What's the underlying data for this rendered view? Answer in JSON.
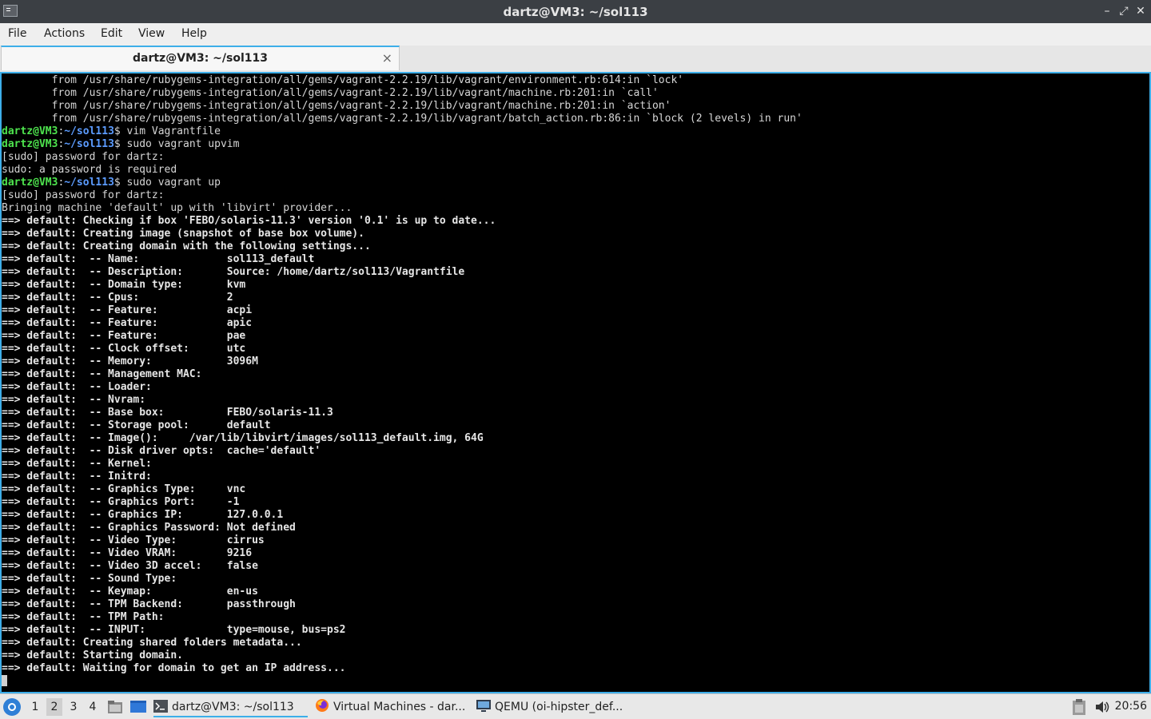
{
  "window": {
    "title": "dartz@VM3: ~/sol113"
  },
  "menu": [
    "File",
    "Actions",
    "Edit",
    "View",
    "Help"
  ],
  "tab": {
    "label": "dartz@VM3: ~/sol113",
    "close_glyph": "×"
  },
  "prompt": {
    "user": "dartz@VM3",
    "path": "~/sol113",
    "symbol": "$"
  },
  "terminal_lines": [
    {
      "kind": "text",
      "text": "        from /usr/share/rubygems-integration/all/gems/vagrant-2.2.19/lib/vagrant/environment.rb:614:in `lock'"
    },
    {
      "kind": "text",
      "text": "        from /usr/share/rubygems-integration/all/gems/vagrant-2.2.19/lib/vagrant/machine.rb:201:in `call'"
    },
    {
      "kind": "text",
      "text": "        from /usr/share/rubygems-integration/all/gems/vagrant-2.2.19/lib/vagrant/machine.rb:201:in `action'"
    },
    {
      "kind": "text",
      "text": "        from /usr/share/rubygems-integration/all/gems/vagrant-2.2.19/lib/vagrant/batch_action.rb:86:in `block (2 levels) in run'"
    },
    {
      "kind": "prompt",
      "cmd": " vim Vagrantfile"
    },
    {
      "kind": "prompt",
      "cmd": " sudo vagrant upvim"
    },
    {
      "kind": "text",
      "text": "[sudo] password for dartz:"
    },
    {
      "kind": "text",
      "text": "sudo: a password is required"
    },
    {
      "kind": "prompt",
      "cmd": " sudo vagrant up"
    },
    {
      "kind": "text",
      "text": "[sudo] password for dartz:"
    },
    {
      "kind": "text",
      "text": "Bringing machine 'default' up with 'libvirt' provider..."
    },
    {
      "kind": "vagrant",
      "text": "Checking if box 'FEBO/solaris-11.3' version '0.1' is up to date..."
    },
    {
      "kind": "vagrant",
      "text": "Creating image (snapshot of base box volume)."
    },
    {
      "kind": "vagrant",
      "text": "Creating domain with the following settings..."
    },
    {
      "kind": "vagrant",
      "text": " -- Name:              sol113_default"
    },
    {
      "kind": "vagrant",
      "text": " -- Description:       Source: /home/dartz/sol113/Vagrantfile"
    },
    {
      "kind": "vagrant",
      "text": " -- Domain type:       kvm"
    },
    {
      "kind": "vagrant",
      "text": " -- Cpus:              2"
    },
    {
      "kind": "vagrant",
      "text": " -- Feature:           acpi"
    },
    {
      "kind": "vagrant",
      "text": " -- Feature:           apic"
    },
    {
      "kind": "vagrant",
      "text": " -- Feature:           pae"
    },
    {
      "kind": "vagrant",
      "text": " -- Clock offset:      utc"
    },
    {
      "kind": "vagrant",
      "text": " -- Memory:            3096M"
    },
    {
      "kind": "vagrant",
      "text": " -- Management MAC:"
    },
    {
      "kind": "vagrant",
      "text": " -- Loader:"
    },
    {
      "kind": "vagrant",
      "text": " -- Nvram:"
    },
    {
      "kind": "vagrant",
      "text": " -- Base box:          FEBO/solaris-11.3"
    },
    {
      "kind": "vagrant",
      "text": " -- Storage pool:      default"
    },
    {
      "kind": "vagrant",
      "text": " -- Image():     /var/lib/libvirt/images/sol113_default.img, 64G"
    },
    {
      "kind": "vagrant",
      "text": " -- Disk driver opts:  cache='default'"
    },
    {
      "kind": "vagrant",
      "text": " -- Kernel:"
    },
    {
      "kind": "vagrant",
      "text": " -- Initrd:"
    },
    {
      "kind": "vagrant",
      "text": " -- Graphics Type:     vnc"
    },
    {
      "kind": "vagrant",
      "text": " -- Graphics Port:     -1"
    },
    {
      "kind": "vagrant",
      "text": " -- Graphics IP:       127.0.0.1"
    },
    {
      "kind": "vagrant",
      "text": " -- Graphics Password: Not defined"
    },
    {
      "kind": "vagrant",
      "text": " -- Video Type:        cirrus"
    },
    {
      "kind": "vagrant",
      "text": " -- Video VRAM:        9216"
    },
    {
      "kind": "vagrant",
      "text": " -- Video 3D accel:    false"
    },
    {
      "kind": "vagrant",
      "text": " -- Sound Type:"
    },
    {
      "kind": "vagrant",
      "text": " -- Keymap:            en-us"
    },
    {
      "kind": "vagrant",
      "text": " -- TPM Backend:       passthrough"
    },
    {
      "kind": "vagrant",
      "text": " -- TPM Path:"
    },
    {
      "kind": "vagrant",
      "text": " -- INPUT:             type=mouse, bus=ps2"
    },
    {
      "kind": "vagrant",
      "text": "Creating shared folders metadata..."
    },
    {
      "kind": "vagrant",
      "text": "Starting domain."
    },
    {
      "kind": "vagrant",
      "text": "Waiting for domain to get an IP address..."
    },
    {
      "kind": "cursor"
    }
  ],
  "vagrant_prefix": "==> default: ",
  "taskbar": {
    "workspaces": [
      "1",
      "2",
      "3",
      "4"
    ],
    "active_workspace_index": 1,
    "tasks": [
      {
        "label": "dartz@VM3: ~/sol113",
        "icon": "terminal-icon",
        "active": true
      },
      {
        "label": "Virtual Machines - dar...",
        "icon": "firefox-icon",
        "active": false
      },
      {
        "label": "QEMU (oi-hipster_def...",
        "icon": "monitor-icon",
        "active": false
      }
    ],
    "clock": "20:56"
  },
  "colors": {
    "accent": "#3daee9",
    "prompt_user": "#4ee44e",
    "prompt_path": "#5c9cff"
  }
}
